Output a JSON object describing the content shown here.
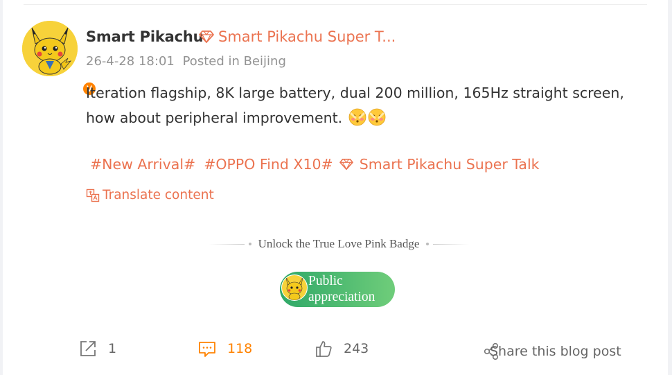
{
  "author": {
    "name": "Smart Pikachu",
    "super_talk_tag": "Smart Pikachu Super T...",
    "verified_badge": "V"
  },
  "meta": {
    "timestamp": "26-4-28 18:01",
    "location": "Posted in Beijing"
  },
  "post": {
    "text": " Iteration flagship, 8K large battery, dual 200 million, 165Hz straight screen, how about peripheral improvement.",
    "emojis": [
      "shy-face-emoji",
      "shy-face-emoji"
    ]
  },
  "tags": {
    "items": [
      "#New Arrival#",
      "#OPPO Find X10#"
    ],
    "super_talk": "Smart Pikachu Super Talk"
  },
  "translate": {
    "label": "Translate content"
  },
  "unlock_banner": {
    "label": "Unlock the True Love Pink Badge"
  },
  "appreciate": {
    "line1": "Public",
    "line2": "appreciation"
  },
  "actions": {
    "repost_count": "1",
    "comment_count": "118",
    "like_count": "243",
    "share_label": "Share this blog post"
  },
  "colors": {
    "accent": "#eb7350",
    "comment_orange": "#ff8200",
    "appreciate_green_start": "#2fa868",
    "appreciate_green_end": "#6fcd7a",
    "avatar_yellow": "#f7d23a"
  }
}
